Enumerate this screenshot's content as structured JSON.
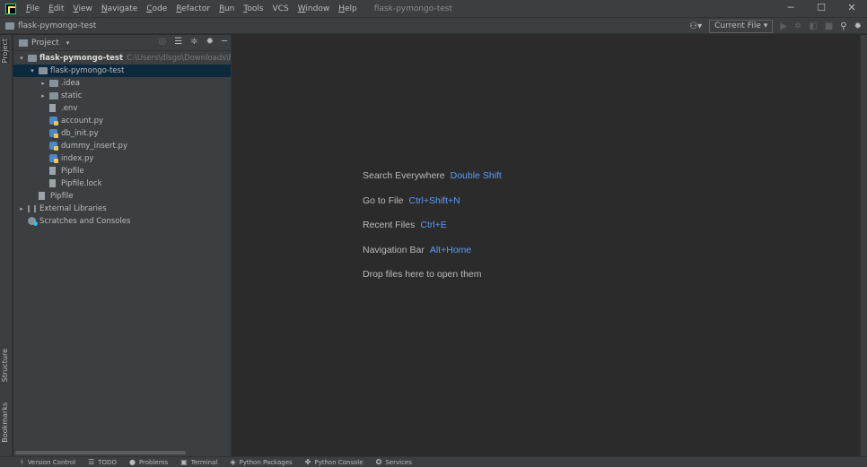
{
  "menu": {
    "items": [
      {
        "u": "F",
        "rest": "ile"
      },
      {
        "u": "E",
        "rest": "dit"
      },
      {
        "u": "V",
        "rest": "iew"
      },
      {
        "u": "N",
        "rest": "avigate"
      },
      {
        "u": "C",
        "rest": "ode"
      },
      {
        "u": "R",
        "rest": "efactor"
      },
      {
        "u": "R",
        "rest": "un",
        "pre": ""
      },
      {
        "u": "T",
        "rest": "ools"
      },
      {
        "u": "",
        "rest": "VCS"
      },
      {
        "u": "W",
        "rest": "indow"
      },
      {
        "u": "H",
        "rest": "elp"
      }
    ],
    "title": "flask-pymongo-test"
  },
  "window_controls": {
    "minimize": "─",
    "maximize": "☐",
    "close": "✕"
  },
  "navbar": {
    "breadcrumb": "flask-pymongo-test",
    "run_config": "Current File",
    "run_config_caret": "▾"
  },
  "left_strip": {
    "project": "Project",
    "structure": "Structure",
    "bookmarks": "Bookmarks"
  },
  "project_panel": {
    "title": "Project",
    "caret": "▾",
    "tree": [
      {
        "label": "flask-pymongo-test",
        "path": "C:\\Users\\dlsgo\\Downloads\\flask",
        "arrow": "v",
        "icon": "folder",
        "indent": 0,
        "bold": true,
        "selected": false
      },
      {
        "label": "flask-pymongo-test",
        "arrow": "v",
        "icon": "folder",
        "indent": 1,
        "selected": true
      },
      {
        "label": ".idea",
        "arrow": ">",
        "icon": "folder",
        "indent": 2
      },
      {
        "label": "static",
        "arrow": ">",
        "icon": "folder",
        "indent": 2
      },
      {
        "label": ".env",
        "arrow": "",
        "icon": "file",
        "indent": 2
      },
      {
        "label": "account.py",
        "arrow": "",
        "icon": "py",
        "indent": 2
      },
      {
        "label": "db_init.py",
        "arrow": "",
        "icon": "py",
        "indent": 2
      },
      {
        "label": "dummy_insert.py",
        "arrow": "",
        "icon": "py",
        "indent": 2
      },
      {
        "label": "index.py",
        "arrow": "",
        "icon": "py",
        "indent": 2
      },
      {
        "label": "Pipfile",
        "arrow": "",
        "icon": "file",
        "indent": 2
      },
      {
        "label": "Pipfile.lock",
        "arrow": "",
        "icon": "file",
        "indent": 2
      },
      {
        "label": "Pipfile",
        "arrow": "",
        "icon": "file",
        "indent": 1
      },
      {
        "label": "External Libraries",
        "arrow": ">",
        "icon": "lib",
        "indent": 0
      },
      {
        "label": "Scratches and Consoles",
        "arrow": "",
        "icon": "scratch",
        "indent": 0
      }
    ]
  },
  "editor_hints": [
    {
      "text": "Search Everywhere",
      "key": "Double Shift"
    },
    {
      "text": "Go to File",
      "key": "Ctrl+Shift+N"
    },
    {
      "text": "Recent Files",
      "key": "Ctrl+E"
    },
    {
      "text": "Navigation Bar",
      "key": "Alt+Home"
    },
    {
      "text": "Drop files here to open them",
      "key": ""
    }
  ],
  "status_tools": [
    {
      "label": "Version Control",
      "icon": "version-control-icon"
    },
    {
      "label": "TODO",
      "icon": "todo-icon"
    },
    {
      "label": "Problems",
      "icon": "problems-icon"
    },
    {
      "label": "Terminal",
      "icon": "terminal-icon"
    },
    {
      "label": "Python Packages",
      "icon": "python-packages-icon"
    },
    {
      "label": "Python Console",
      "icon": "python-console-icon"
    },
    {
      "label": "Services",
      "icon": "services-icon"
    }
  ],
  "colors": {
    "background": "#2b2b2b",
    "panel": "#3c3f41",
    "selection": "#0d293e",
    "shortcut": "#589df6"
  }
}
